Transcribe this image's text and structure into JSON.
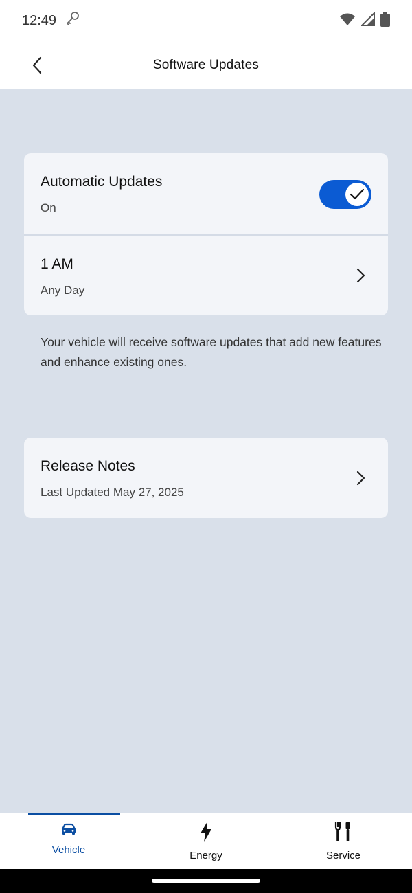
{
  "status_bar": {
    "time": "12:49",
    "icons": [
      "key-icon",
      "wifi-icon",
      "signal-icon",
      "battery-icon"
    ]
  },
  "app_bar": {
    "title": "Software Updates",
    "back_icon": "chevron-left-icon"
  },
  "auto_updates_card": {
    "title": "Automatic Updates",
    "status": "On",
    "toggle_on": true,
    "schedule_time": "1 AM",
    "schedule_days": "Any Day"
  },
  "description": "Your vehicle will receive software updates that add new features and enhance existing ones.",
  "release_notes_card": {
    "title": "Release Notes",
    "subtitle": "Last Updated May 27, 2025"
  },
  "bottom_nav": {
    "items": [
      {
        "label": "Vehicle",
        "icon": "car-icon",
        "active": true
      },
      {
        "label": "Energy",
        "icon": "lightning-icon",
        "active": false
      },
      {
        "label": "Service",
        "icon": "tools-icon",
        "active": false
      }
    ]
  },
  "colors": {
    "accent": "#0b5bd3",
    "active_nav": "#0b4ea2",
    "background": "#d9e0ea",
    "card": "#f3f5f9"
  }
}
